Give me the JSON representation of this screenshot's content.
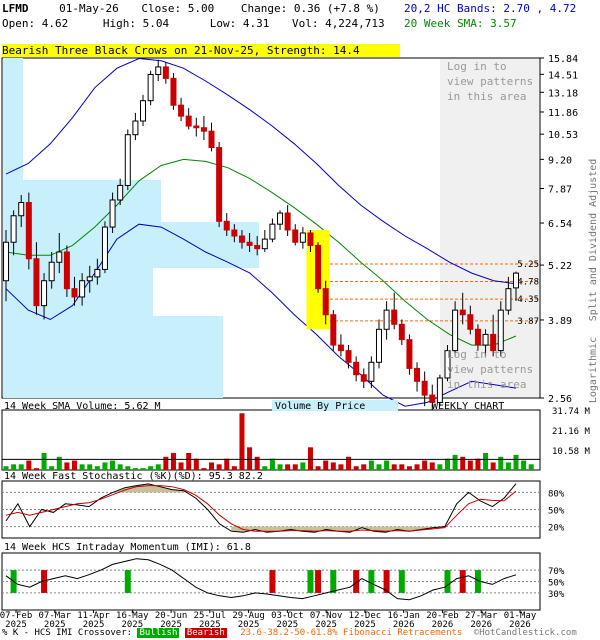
{
  "header": {
    "symbol": "LFMD",
    "date": "01-May-26",
    "close": "Close: 5.00",
    "change": "Change: 0.36 (+7.8 %)",
    "open": "Open: 4.62",
    "high": "High: 5.04",
    "low": "Low: 4.31",
    "vol": "Vol: 4,224,713",
    "bands": "20,2 HC Bands: 2.70 , 4.72",
    "sma": "20 Week SMA: 3.57",
    "bands_color": "#0000cc",
    "sma_color": "#008800"
  },
  "pattern_banner": "Bearish Three Black Crows on 21-Nov-25, Strength: 14.4",
  "login_text": [
    "Log in to",
    "view patterns",
    "in this area"
  ],
  "side_labels": {
    "right": "Split and Dividend Adjusted",
    "right2": "Logarithmic"
  },
  "footer": {
    "legend_prefix": "% K - HCS IMI Crossover:",
    "bullish": "Bullish",
    "bearish": "Bearish",
    "fib": "23.6-38.2-50-61.8% Fibonacci Retracements",
    "copyright": "©HotCandlestick.com"
  },
  "panel_titles": {
    "volume": "14 Week SMA Volume: 5.62 M",
    "vbp": "Volume By Price",
    "weekly": "WEEKLY CHART",
    "stoch": "14 Week Fast Stochastic (%K)(%D): 95.3 82.2",
    "imi": "14 Week HCS Intraday Momentum (IMI): 61.8"
  },
  "chart_data": [
    {
      "type": "candlestick",
      "scale": "log",
      "y_ticks": [
        "15.84",
        "14.51",
        "13.18",
        "11.86",
        "10.53",
        "9.20",
        "7.87",
        "6.54",
        "5.22",
        "3.89",
        "2.56"
      ],
      "fib_levels": [
        "5.25",
        "4.78",
        "4.35",
        "3.87"
      ],
      "x_labels": [
        [
          "07-Feb",
          "2025"
        ],
        [
          "07-Mar",
          "2025"
        ],
        [
          "11-Apr",
          "2025"
        ],
        [
          "16-May",
          "2025"
        ],
        [
          "20-Jun",
          "2025"
        ],
        [
          "25-Jul",
          "2025"
        ],
        [
          "29-Aug",
          "2025"
        ],
        [
          "03-Oct",
          "2025"
        ],
        [
          "07-Nov",
          "2025"
        ],
        [
          "12-Dec",
          "2025"
        ],
        [
          "16-Jan",
          "2026"
        ],
        [
          "20-Feb",
          "2026"
        ],
        [
          "27-Mar",
          "2026"
        ],
        [
          "01-May",
          "2026"
        ]
      ],
      "candles": [
        {
          "o": 4.8,
          "h": 6.3,
          "l": 4.3,
          "c": 5.9
        },
        {
          "o": 5.9,
          "h": 7.0,
          "l": 5.5,
          "c": 6.8
        },
        {
          "o": 6.8,
          "h": 7.6,
          "l": 6.4,
          "c": 7.3
        },
        {
          "o": 7.3,
          "h": 7.7,
          "l": 5.1,
          "c": 5.4
        },
        {
          "o": 5.4,
          "h": 5.9,
          "l": 4.0,
          "c": 4.2
        },
        {
          "o": 4.2,
          "h": 5.0,
          "l": 3.9,
          "c": 4.8
        },
        {
          "o": 4.8,
          "h": 5.6,
          "l": 4.6,
          "c": 5.3
        },
        {
          "o": 5.3,
          "h": 6.2,
          "l": 5.0,
          "c": 5.6
        },
        {
          "o": 5.6,
          "h": 5.8,
          "l": 4.4,
          "c": 4.6
        },
        {
          "o": 4.6,
          "h": 4.9,
          "l": 4.2,
          "c": 4.4
        },
        {
          "o": 4.4,
          "h": 5.0,
          "l": 4.2,
          "c": 4.8
        },
        {
          "o": 4.8,
          "h": 5.2,
          "l": 4.5,
          "c": 4.9
        },
        {
          "o": 4.9,
          "h": 5.4,
          "l": 4.7,
          "c": 5.1
        },
        {
          "o": 5.1,
          "h": 6.6,
          "l": 5.0,
          "c": 6.4
        },
        {
          "o": 6.4,
          "h": 7.7,
          "l": 6.2,
          "c": 7.4
        },
        {
          "o": 7.4,
          "h": 8.3,
          "l": 7.2,
          "c": 8.0
        },
        {
          "o": 8.0,
          "h": 10.8,
          "l": 7.8,
          "c": 10.5
        },
        {
          "o": 10.5,
          "h": 11.8,
          "l": 10.2,
          "c": 11.3
        },
        {
          "o": 11.3,
          "h": 13.0,
          "l": 11.0,
          "c": 12.6
        },
        {
          "o": 12.6,
          "h": 14.8,
          "l": 12.3,
          "c": 14.5
        },
        {
          "o": 14.5,
          "h": 15.7,
          "l": 14.0,
          "c": 15.1
        },
        {
          "o": 15.1,
          "h": 15.5,
          "l": 13.8,
          "c": 14.2
        },
        {
          "o": 14.2,
          "h": 14.6,
          "l": 12.0,
          "c": 12.3
        },
        {
          "o": 12.3,
          "h": 12.8,
          "l": 11.3,
          "c": 11.6
        },
        {
          "o": 11.6,
          "h": 12.1,
          "l": 10.8,
          "c": 11.0
        },
        {
          "o": 11.0,
          "h": 11.5,
          "l": 10.4,
          "c": 10.9
        },
        {
          "o": 10.9,
          "h": 11.6,
          "l": 10.2,
          "c": 10.7
        },
        {
          "o": 10.7,
          "h": 11.2,
          "l": 9.6,
          "c": 9.8
        },
        {
          "o": 9.8,
          "h": 10.1,
          "l": 6.4,
          "c": 6.6
        },
        {
          "o": 6.6,
          "h": 6.9,
          "l": 6.1,
          "c": 6.3
        },
        {
          "o": 6.3,
          "h": 6.5,
          "l": 5.9,
          "c": 6.1
        },
        {
          "o": 6.1,
          "h": 6.3,
          "l": 5.7,
          "c": 5.9
        },
        {
          "o": 5.9,
          "h": 6.2,
          "l": 5.6,
          "c": 5.8
        },
        {
          "o": 5.8,
          "h": 6.1,
          "l": 5.5,
          "c": 5.7
        },
        {
          "o": 5.7,
          "h": 6.3,
          "l": 5.6,
          "c": 6.0
        },
        {
          "o": 6.0,
          "h": 6.7,
          "l": 5.9,
          "c": 6.5
        },
        {
          "o": 6.5,
          "h": 7.0,
          "l": 6.3,
          "c": 6.9
        },
        {
          "o": 6.9,
          "h": 7.2,
          "l": 6.1,
          "c": 6.3
        },
        {
          "o": 6.3,
          "h": 6.5,
          "l": 5.8,
          "c": 5.9
        },
        {
          "o": 5.9,
          "h": 6.4,
          "l": 5.7,
          "c": 6.2
        },
        {
          "o": 6.2,
          "h": 6.3,
          "l": 5.6,
          "c": 5.8
        },
        {
          "o": 5.8,
          "h": 5.9,
          "l": 4.5,
          "c": 4.6
        },
        {
          "o": 4.6,
          "h": 4.8,
          "l": 3.8,
          "c": 4.0
        },
        {
          "o": 4.0,
          "h": 4.1,
          "l": 3.3,
          "c": 3.4
        },
        {
          "o": 3.4,
          "h": 3.6,
          "l": 3.2,
          "c": 3.3
        },
        {
          "o": 3.3,
          "h": 3.4,
          "l": 3.0,
          "c": 3.1
        },
        {
          "o": 3.1,
          "h": 3.2,
          "l": 2.8,
          "c": 2.9
        },
        {
          "o": 2.9,
          "h": 3.0,
          "l": 2.7,
          "c": 2.8
        },
        {
          "o": 2.8,
          "h": 3.2,
          "l": 2.7,
          "c": 3.1
        },
        {
          "o": 3.1,
          "h": 3.9,
          "l": 3.0,
          "c": 3.7
        },
        {
          "o": 3.7,
          "h": 4.3,
          "l": 3.5,
          "c": 4.1
        },
        {
          "o": 4.1,
          "h": 4.5,
          "l": 3.7,
          "c": 3.8
        },
        {
          "o": 3.8,
          "h": 3.9,
          "l": 3.4,
          "c": 3.5
        },
        {
          "o": 3.5,
          "h": 3.6,
          "l": 2.9,
          "c": 3.0
        },
        {
          "o": 3.0,
          "h": 3.1,
          "l": 2.65,
          "c": 2.8
        },
        {
          "o": 2.8,
          "h": 2.95,
          "l": 2.45,
          "c": 2.6
        },
        {
          "o": 2.6,
          "h": 2.75,
          "l": 2.4,
          "c": 2.5
        },
        {
          "o": 2.5,
          "h": 2.9,
          "l": 2.45,
          "c": 2.85
        },
        {
          "o": 2.85,
          "h": 3.4,
          "l": 2.8,
          "c": 3.3
        },
        {
          "o": 3.3,
          "h": 4.3,
          "l": 3.2,
          "c": 4.1
        },
        {
          "o": 4.1,
          "h": 4.5,
          "l": 3.8,
          "c": 4.0
        },
        {
          "o": 4.0,
          "h": 4.2,
          "l": 3.6,
          "c": 3.7
        },
        {
          "o": 3.7,
          "h": 3.8,
          "l": 3.3,
          "c": 3.4
        },
        {
          "o": 3.4,
          "h": 3.7,
          "l": 3.2,
          "c": 3.6
        },
        {
          "o": 3.6,
          "h": 4.0,
          "l": 3.2,
          "c": 3.3
        },
        {
          "o": 3.3,
          "h": 4.3,
          "l": 3.2,
          "c": 4.1
        },
        {
          "o": 4.1,
          "h": 4.9,
          "l": 4.0,
          "c": 4.6
        },
        {
          "o": 4.62,
          "h": 5.04,
          "l": 4.31,
          "c": 5.0
        }
      ],
      "bb_upper": [
        8.5,
        9.0,
        10.0,
        11.5,
        13.5,
        15.0,
        15.8,
        15.6,
        15.0,
        14.0,
        13.0,
        12.0,
        11.0,
        10.0,
        9.0,
        8.0,
        7.2,
        6.6,
        6.1,
        5.7,
        5.3,
        5.0,
        4.8,
        4.72
      ],
      "bb_lower": [
        4.6,
        4.1,
        3.9,
        4.2,
        5.0,
        6.0,
        6.5,
        6.4,
        6.0,
        5.6,
        5.3,
        5.0,
        4.5,
        4.0,
        3.6,
        3.2,
        2.9,
        2.6,
        2.45,
        2.5,
        2.65,
        2.8,
        2.75,
        2.7
      ],
      "sma20": [
        5.6,
        5.5,
        5.5,
        5.8,
        6.4,
        7.2,
        8.2,
        8.9,
        9.2,
        9.1,
        8.8,
        8.3,
        7.7,
        7.1,
        6.5,
        5.9,
        5.3,
        4.8,
        4.3,
        3.9,
        3.6,
        3.4,
        3.4,
        3.57
      ]
    },
    {
      "type": "bar",
      "name": "volume",
      "y_ticks": [
        "31.74 M",
        "21.16 M",
        "10.58 M"
      ],
      "values": [
        2,
        3,
        3,
        5,
        1,
        9,
        2,
        7,
        4,
        5,
        3,
        3,
        2,
        4,
        5,
        3,
        2,
        1,
        1,
        2,
        3,
        7,
        9,
        4,
        9,
        6,
        1,
        4,
        3,
        6,
        2,
        30,
        12,
        7,
        2,
        6,
        3,
        3,
        3,
        4,
        12,
        2,
        5,
        4,
        3,
        7,
        2,
        3,
        5,
        3,
        5,
        3,
        3,
        2,
        3,
        5,
        4,
        3,
        6,
        8,
        7,
        5,
        6,
        9,
        4,
        7,
        4,
        8,
        5,
        3
      ],
      "sma": 5.62
    },
    {
      "type": "line",
      "name": "stochastic",
      "y_ticks": [
        "80%",
        "50%",
        "20%"
      ],
      "k": [
        30,
        60,
        20,
        50,
        45,
        60,
        58,
        55,
        70,
        80,
        88,
        92,
        95,
        90,
        85,
        83,
        70,
        50,
        25,
        12,
        10,
        15,
        10,
        12,
        15,
        12,
        10,
        15,
        12,
        10,
        18,
        12,
        10,
        15,
        12,
        15,
        18,
        20,
        60,
        80,
        65,
        55,
        70,
        95.3
      ],
      "d": [
        40,
        45,
        40,
        45,
        50,
        55,
        60,
        62,
        68,
        76,
        84,
        90,
        92,
        92,
        90,
        85,
        75,
        60,
        40,
        25,
        15,
        12,
        12,
        12,
        13,
        13,
        12,
        13,
        12,
        12,
        14,
        13,
        12,
        13,
        12,
        14,
        16,
        18,
        40,
        60,
        68,
        66,
        65,
        82.2
      ]
    },
    {
      "type": "line",
      "name": "imi",
      "y_ticks": [
        "70%",
        "50%",
        "30%"
      ],
      "values": [
        60,
        45,
        40,
        50,
        55,
        60,
        55,
        62,
        70,
        80,
        85,
        90,
        88,
        80,
        70,
        55,
        40,
        30,
        25,
        22,
        25,
        30,
        28,
        25,
        22,
        20,
        25,
        30,
        35,
        40,
        55,
        45,
        35,
        20,
        18,
        25,
        35,
        40,
        55,
        60,
        50,
        45,
        55,
        61.8
      ],
      "bullish_markers": [
        1,
        16,
        40,
        43,
        48,
        52,
        58,
        62
      ],
      "bearish_markers": [
        5,
        35,
        41,
        46,
        50,
        60
      ]
    }
  ],
  "colors": {
    "up": "#00aa00",
    "down": "#cc0000",
    "candle_up_fill": "#ffffff",
    "vbp": "#c8f0fc",
    "bb": "#0000cc",
    "sma": "#008800",
    "fib": "#ff6600",
    "banner": "#ffff00"
  }
}
